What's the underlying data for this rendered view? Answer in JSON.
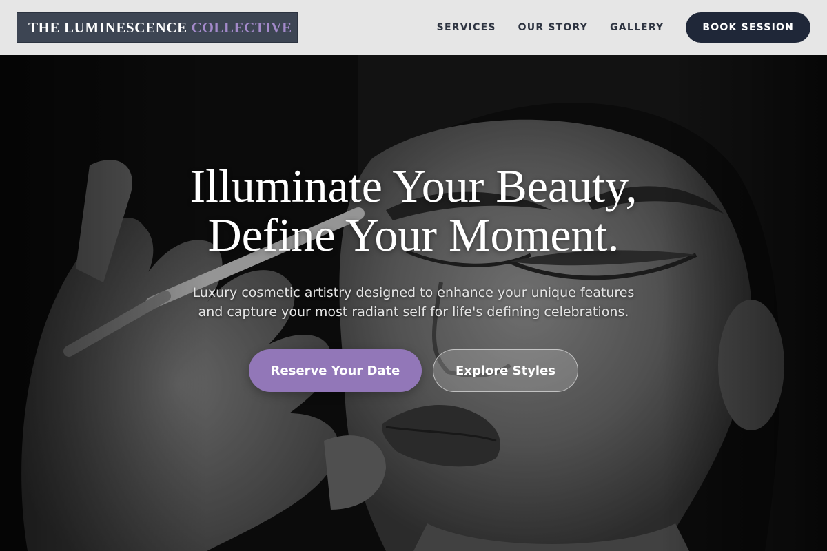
{
  "brand": {
    "name_part1": "THE LUMINESCENCE",
    "name_part2": "COLLECTIVE",
    "accent_color": "#a48acb"
  },
  "nav": {
    "links": [
      "SERVICES",
      "OUR STORY",
      "GALLERY"
    ],
    "cta_label": "BOOK SESSION"
  },
  "hero": {
    "headline_line1": "Illuminate Your Beauty,",
    "headline_line2": "Define Your Moment.",
    "subtext_line1": "Luxury cosmetic artistry designed to enhance your unique features",
    "subtext_line2": "and capture your most radiant self for life's defining celebrations.",
    "primary_cta": "Reserve Your Date",
    "secondary_cta": "Explore Styles",
    "primary_color": "#9277b8",
    "background_image": "black-and-white photo of a makeup artist applying eye makeup to a woman with closed eyes"
  }
}
